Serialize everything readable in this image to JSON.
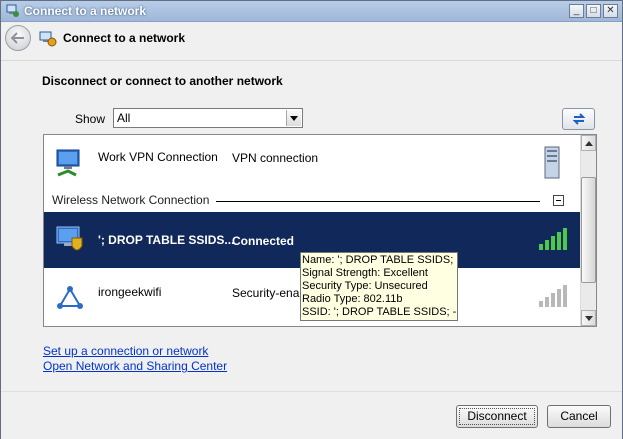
{
  "window": {
    "title": "Connect to a network",
    "title_bar_buttons": [
      "minimize",
      "maximize",
      "close"
    ]
  },
  "nav": {
    "title": "Connect to a network"
  },
  "heading": "Disconnect or connect to another network",
  "show": {
    "label": "Show",
    "selected": "All"
  },
  "group": {
    "label": "Wireless Network Connection"
  },
  "networks": [
    {
      "name": "Work VPN Connection",
      "status": "VPN connection",
      "icon": "vpn-network-icon",
      "signal_icon": "server-icon"
    },
    {
      "name": "'; DROP TABLE SSIDS...",
      "status": "Connected",
      "icon": "wireless-shield-icon",
      "signal_icon": "signal-strength-excellent-icon",
      "selected": true,
      "signal_color": "#4cc84c"
    },
    {
      "name": "irongeekwifi",
      "status": "Security-enab",
      "icon": "wireless-network-icon",
      "signal_icon": "signal-strength-gray-icon"
    }
  ],
  "tooltip": {
    "name": "Name: '; DROP TABLE SSIDS; --",
    "signal": "Signal Strength: Excellent",
    "security": "Security Type: Unsecured",
    "radio": "Radio Type: 802.11b",
    "ssid": "SSID: '; DROP TABLE SSIDS; --"
  },
  "links": {
    "setup": "Set up a connection or network",
    "sharing": "Open Network and Sharing Center"
  },
  "buttons": {
    "disconnect": "Disconnect",
    "cancel": "Cancel"
  },
  "colors": {
    "selection": "#10285a",
    "link": "#0033cc",
    "tooltip_bg": "#ffffe1"
  }
}
